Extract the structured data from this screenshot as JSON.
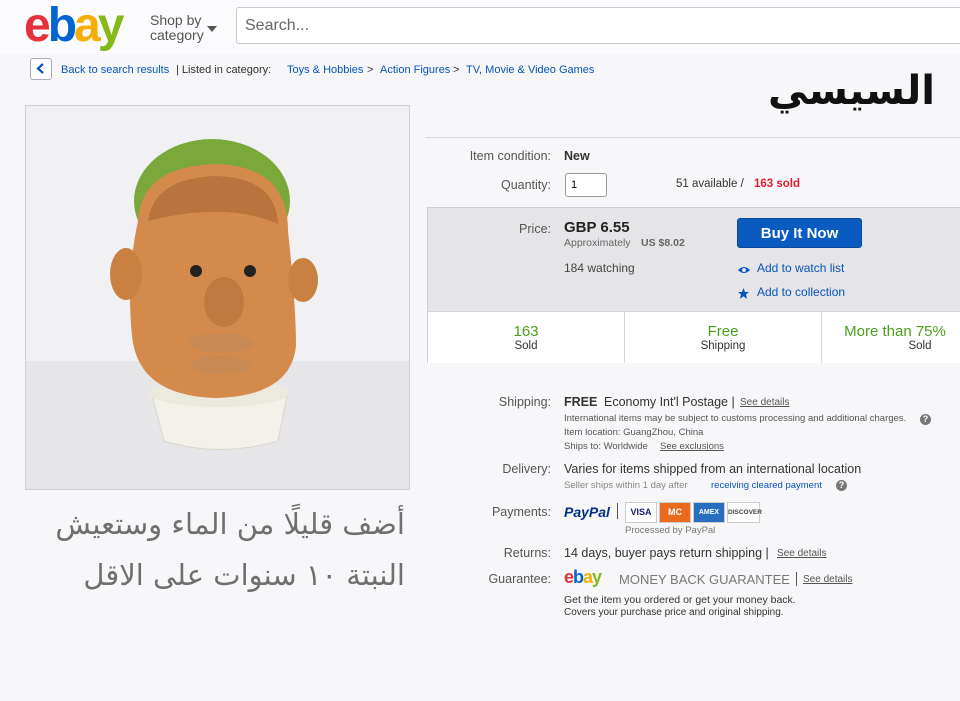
{
  "header": {
    "logo": [
      "e",
      "b",
      "a",
      "y"
    ],
    "logo_colors": [
      "#e53238",
      "#0064d2",
      "#f5af02",
      "#86b817"
    ],
    "shop_by_line1": "Shop by",
    "shop_by_line2": "category",
    "search_placeholder": "Search..."
  },
  "breadcrumb": {
    "back": "Back to search results",
    "listed_in": "| Listed in category:",
    "items": [
      "Toys & Hobbies",
      ">",
      "Action Figures",
      ">",
      "TV, Movie & Video Games"
    ]
  },
  "title_overlay": "السيسي",
  "caption": {
    "line1": "أضف قليلًا من الماء وستعيش",
    "line2": "النبتة ١٠ سنوات على الاقل"
  },
  "details": {
    "condition_label": "Item condition:",
    "condition_value": "New",
    "quantity_label": "Quantity:",
    "quantity_value": "1",
    "available": "51 available /",
    "sold": "163 sold",
    "price_label": "Price:",
    "price": "GBP 6.55",
    "approx_label": "Approximately",
    "approx_value": "US $8.02",
    "watching": "184 watching",
    "buy_now": "Buy It Now",
    "add_watch": "Add to watch list",
    "add_collection": "Add to collection",
    "stats": [
      {
        "num": "163",
        "label": "Sold"
      },
      {
        "num": "Free",
        "label": "Shipping"
      },
      {
        "num": "More than 75%",
        "label": "Sold"
      }
    ],
    "shipping_label": "Shipping:",
    "shipping_free": "FREE",
    "shipping_method": "Economy Int'l Postage |",
    "see_details": "See details",
    "customs_note": "International items may be subject to customs processing and additional charges.",
    "item_location": "Item location:  GuangZhou, China",
    "ships_to": "Ships to:  Worldwide",
    "see_exclusions": "See exclusions",
    "delivery_label": "Delivery:",
    "delivery_value": "Varies for items shipped from an international location",
    "seller_ships": "Seller ships within 1 day after",
    "receiving_payment": "receiving cleared payment",
    "payments_label": "Payments:",
    "paypal": "PayPal",
    "cards": [
      "VISA",
      "MC",
      "AMEX",
      "DISCOVER"
    ],
    "processed_by": "Processed by PayPal",
    "returns_label": "Returns:",
    "returns_value": "14 days, buyer pays return shipping |",
    "see_details_returns": "See details",
    "guarantee_label": "Guarantee:",
    "guarantee_text": "MONEY BACK GUARANTEE",
    "see_details_guarantee": "See details",
    "guarantee_line1": "Get the item you ordered or get your money back.",
    "guarantee_line2": "Covers your purchase price and original shipping."
  },
  "colors": {
    "sold_red": "#dd1e31",
    "link_blue": "#0654ba",
    "stat_green": "#4c9e1d",
    "buy_blue": "#0a5bc0"
  }
}
